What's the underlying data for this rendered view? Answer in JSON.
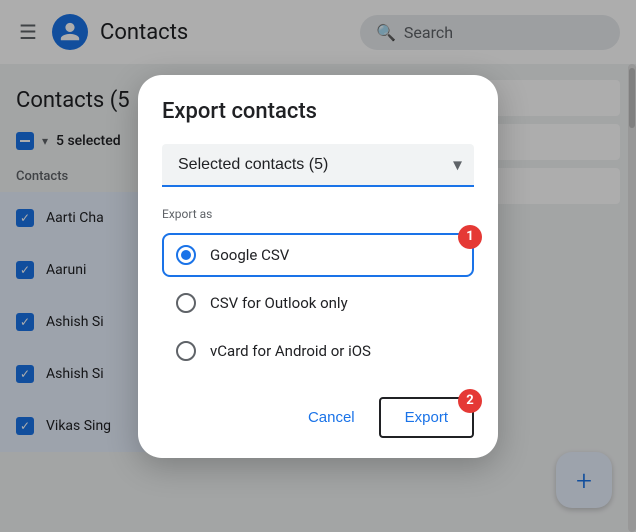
{
  "app": {
    "title": "Contacts",
    "search_placeholder": "Search"
  },
  "toolbar": {
    "selected_label": "5 selected"
  },
  "contacts": {
    "section_title": "Contacts (5",
    "list_header": "Contacts",
    "items": [
      {
        "name": "Aarti Cha"
      },
      {
        "name": "Aaruni"
      },
      {
        "name": "Ashish Si"
      },
      {
        "name": "Ashish Si"
      },
      {
        "name": "Vikas Sing"
      }
    ]
  },
  "modal": {
    "title": "Export contacts",
    "dropdown_label": "Selected contacts (5)",
    "export_as_label": "Export as",
    "radio_options": [
      {
        "id": "google_csv",
        "label": "Google CSV",
        "selected": true
      },
      {
        "id": "csv_outlook",
        "label": "CSV for Outlook only",
        "selected": false
      },
      {
        "id": "vcard",
        "label": "vCard for Android or iOS",
        "selected": false
      }
    ],
    "cancel_label": "Cancel",
    "export_label": "Export",
    "badge_1": "1",
    "badge_2": "2"
  },
  "fab": {
    "label": "+"
  }
}
